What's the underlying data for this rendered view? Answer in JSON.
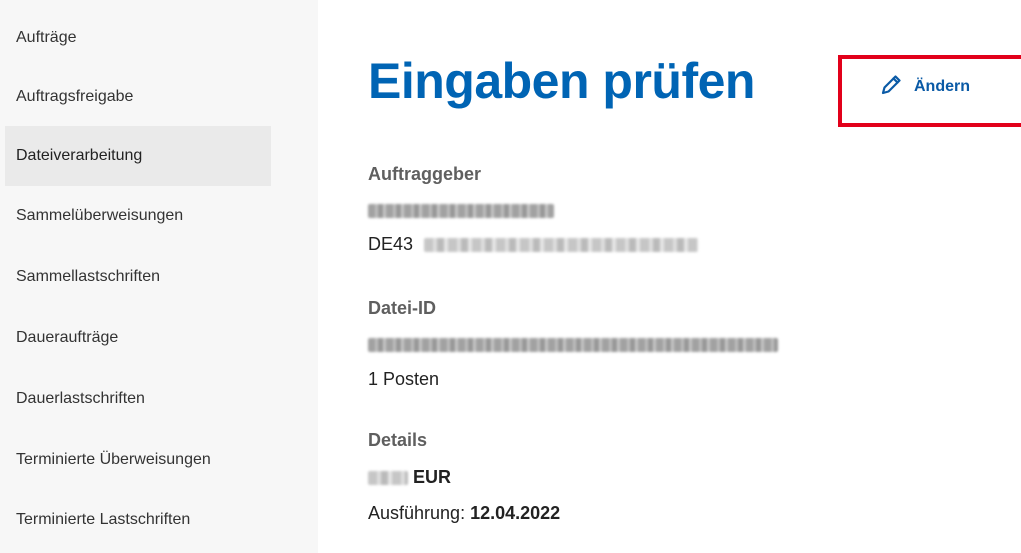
{
  "sidebar": {
    "items": [
      {
        "label": "Aufträge"
      },
      {
        "label": "Auftragsfreigabe"
      },
      {
        "label": "Dateiverarbeitung",
        "active": true
      },
      {
        "label": "Sammelüberweisungen"
      },
      {
        "label": "Sammellastschriften"
      },
      {
        "label": "Daueraufträge"
      },
      {
        "label": "Dauerlastschriften"
      },
      {
        "label": "Terminierte Überweisungen"
      },
      {
        "label": "Terminierte Lastschriften"
      }
    ]
  },
  "main": {
    "title": "Eingaben prüfen",
    "edit_label": "Ändern",
    "auftraggeber": {
      "label": "Auftraggeber",
      "iban_prefix": "DE43"
    },
    "datei": {
      "label": "Datei-ID",
      "posten": "1 Posten"
    },
    "details": {
      "label": "Details",
      "currency": "EUR",
      "execution_label": "Ausführung:",
      "execution_date": "12.04.2022"
    }
  },
  "colors": {
    "title": "#0064b4",
    "link": "#0a5aa6",
    "highlight": "#e2001a",
    "sidebar_bg": "#f7f7f7",
    "active_bg": "#eaeaea"
  },
  "icons": {
    "edit": "pencil-icon"
  }
}
